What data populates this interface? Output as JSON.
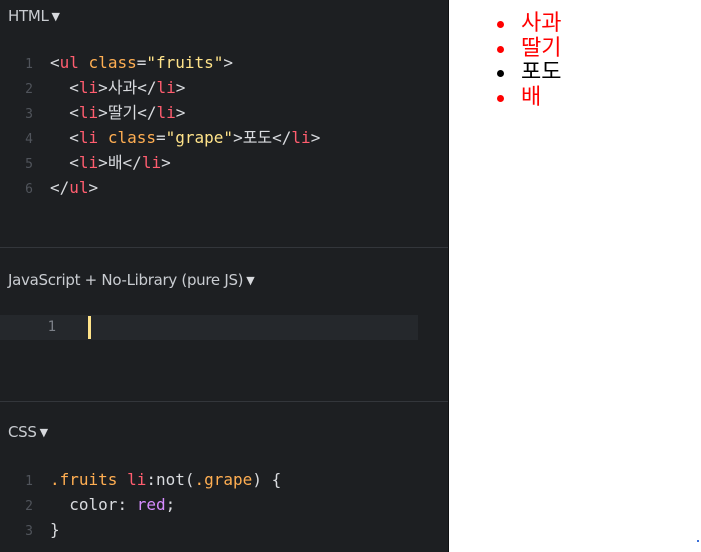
{
  "panels": {
    "html": {
      "title": "HTML",
      "caret": "▼",
      "lines": [
        {
          "num": "1",
          "tokens": [
            {
              "t": "<",
              "k": "punct"
            },
            {
              "t": "ul",
              "k": "tag"
            },
            {
              "t": " ",
              "k": "text"
            },
            {
              "t": "class",
              "k": "attr"
            },
            {
              "t": "=",
              "k": "punct"
            },
            {
              "t": "\"fruits\"",
              "k": "str"
            },
            {
              "t": ">",
              "k": "punct"
            }
          ]
        },
        {
          "num": "2",
          "tokens": [
            {
              "t": "  <",
              "k": "punct"
            },
            {
              "t": "li",
              "k": "tag"
            },
            {
              "t": ">",
              "k": "punct"
            },
            {
              "t": "사과",
              "k": "text"
            },
            {
              "t": "</",
              "k": "punct"
            },
            {
              "t": "li",
              "k": "tag"
            },
            {
              "t": ">",
              "k": "punct"
            }
          ]
        },
        {
          "num": "3",
          "tokens": [
            {
              "t": "  <",
              "k": "punct"
            },
            {
              "t": "li",
              "k": "tag"
            },
            {
              "t": ">",
              "k": "punct"
            },
            {
              "t": "딸기",
              "k": "text"
            },
            {
              "t": "</",
              "k": "punct"
            },
            {
              "t": "li",
              "k": "tag"
            },
            {
              "t": ">",
              "k": "punct"
            }
          ]
        },
        {
          "num": "4",
          "tokens": [
            {
              "t": "  <",
              "k": "punct"
            },
            {
              "t": "li",
              "k": "tag"
            },
            {
              "t": " ",
              "k": "text"
            },
            {
              "t": "class",
              "k": "attr"
            },
            {
              "t": "=",
              "k": "punct"
            },
            {
              "t": "\"grape\"",
              "k": "str"
            },
            {
              "t": ">",
              "k": "punct"
            },
            {
              "t": "포도",
              "k": "text"
            },
            {
              "t": "</",
              "k": "punct"
            },
            {
              "t": "li",
              "k": "tag"
            },
            {
              "t": ">",
              "k": "punct"
            }
          ]
        },
        {
          "num": "5",
          "tokens": [
            {
              "t": "  <",
              "k": "punct"
            },
            {
              "t": "li",
              "k": "tag"
            },
            {
              "t": ">",
              "k": "punct"
            },
            {
              "t": "배",
              "k": "text"
            },
            {
              "t": "</",
              "k": "punct"
            },
            {
              "t": "li",
              "k": "tag"
            },
            {
              "t": ">",
              "k": "punct"
            }
          ]
        },
        {
          "num": "6",
          "tokens": [
            {
              "t": "</",
              "k": "punct"
            },
            {
              "t": "ul",
              "k": "tag"
            },
            {
              "t": ">",
              "k": "punct"
            }
          ]
        }
      ]
    },
    "js": {
      "title": "JavaScript + No-Library (pure JS)",
      "caret": "▼",
      "line_number": "1"
    },
    "css": {
      "title": "CSS",
      "caret": "▼",
      "lines": [
        {
          "num": "1",
          "tokens": [
            {
              "t": ".fruits",
              "k": "class"
            },
            {
              "t": " ",
              "k": "text"
            },
            {
              "t": "li",
              "k": "tagsel"
            },
            {
              "t": ":not(",
              "k": "punct"
            },
            {
              "t": ".grape",
              "k": "class"
            },
            {
              "t": ") {",
              "k": "punct"
            }
          ]
        },
        {
          "num": "2",
          "tokens": [
            {
              "t": "  color",
              "k": "prop"
            },
            {
              "t": ": ",
              "k": "punct"
            },
            {
              "t": "red",
              "k": "value"
            },
            {
              "t": ";",
              "k": "punct"
            }
          ]
        },
        {
          "num": "3",
          "tokens": [
            {
              "t": "}",
              "k": "punct"
            }
          ]
        }
      ]
    }
  },
  "preview": {
    "items": [
      {
        "text": "사과",
        "color": "red"
      },
      {
        "text": "딸기",
        "color": "red"
      },
      {
        "text": "포도",
        "color": "black"
      },
      {
        "text": "배",
        "color": "red"
      }
    ]
  },
  "colors": {
    "editor_bg": "#1d1f22",
    "tag": "#ff5d6f",
    "attr": "#ffae52",
    "string": "#ffe38a",
    "value": "#d68cff",
    "cursor": "#ffe38a",
    "preview_red": "#ff0000",
    "preview_black": "#000000"
  }
}
